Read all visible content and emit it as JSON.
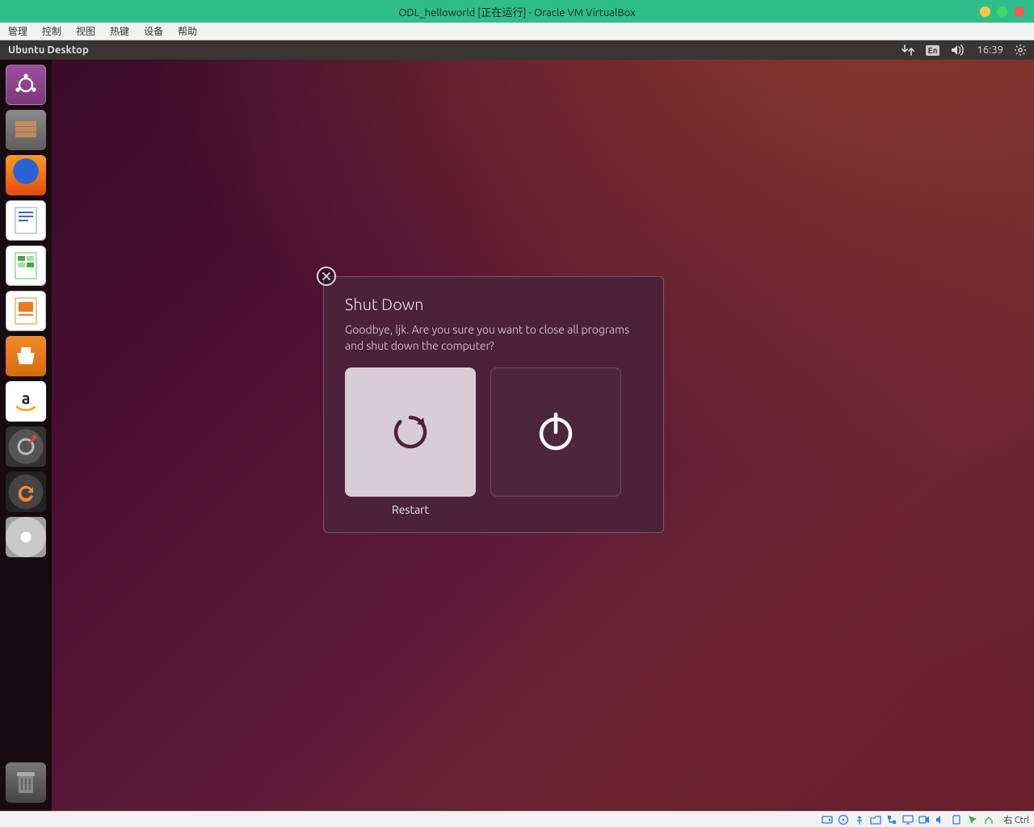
{
  "vbox": {
    "title": "ODL_helloworld [正在运行] - Oracle VM VirtualBox",
    "menu": [
      "管理",
      "控制",
      "视图",
      "热键",
      "设备",
      "帮助"
    ],
    "hostkey": "右 Ctrl"
  },
  "ubuntu": {
    "topbar_title": "Ubuntu Desktop",
    "lang": "En",
    "clock": "16:39"
  },
  "launcher": [
    {
      "name": "dash-icon",
      "cls": "ubuntu"
    },
    {
      "name": "files-icon",
      "cls": "files"
    },
    {
      "name": "firefox-icon",
      "cls": "firefox"
    },
    {
      "name": "writer-icon",
      "cls": "writer"
    },
    {
      "name": "calc-icon",
      "cls": "calc"
    },
    {
      "name": "impress-icon",
      "cls": "impress"
    },
    {
      "name": "ubuntu-software-icon",
      "cls": "software"
    },
    {
      "name": "amazon-icon",
      "cls": "amazon"
    },
    {
      "name": "system-settings-icon",
      "cls": "settings"
    },
    {
      "name": "software-updater-icon",
      "cls": "updater"
    },
    {
      "name": "disc-icon",
      "cls": "disc"
    }
  ],
  "dialog": {
    "title": "Shut Down",
    "message": "Goodbye, ljk. Are you sure you want to close all programs and shut down the computer?",
    "restart_label": "Restart"
  }
}
